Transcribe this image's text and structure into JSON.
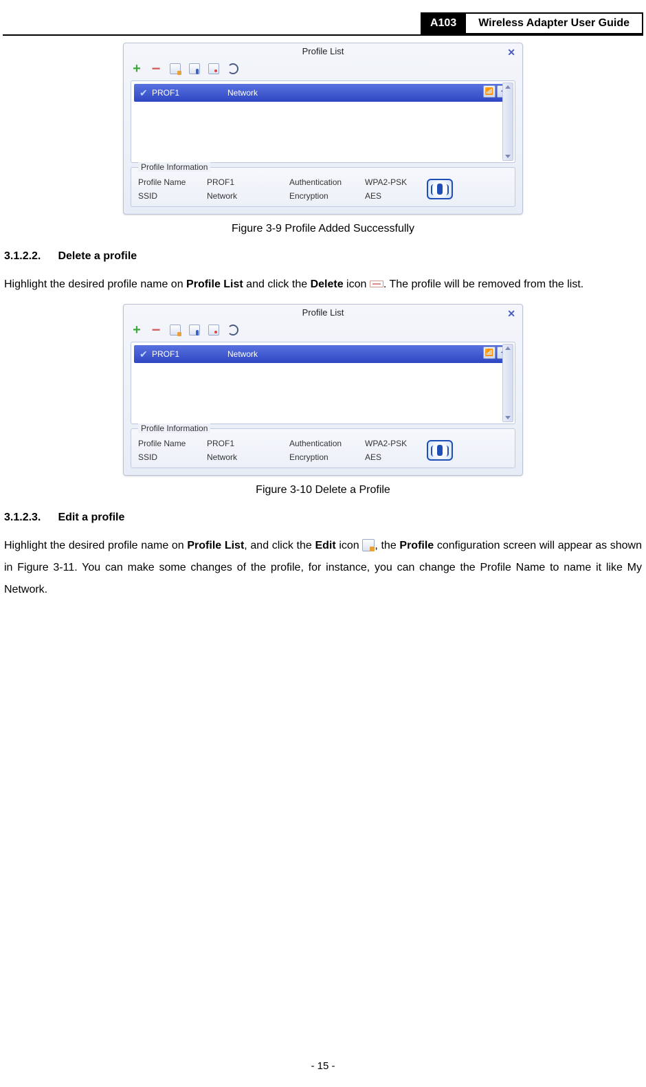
{
  "header": {
    "code": "A103",
    "title": "Wireless Adapter User Guide"
  },
  "figures": {
    "fig1": {
      "window_title": "Profile List",
      "row": {
        "name": "PROF1",
        "ssid": "Network"
      },
      "info": {
        "legend": "Profile Information",
        "profile_name_label": "Profile Name",
        "profile_name_value": "PROF1",
        "ssid_label": "SSID",
        "ssid_value": "Network",
        "auth_label": "Authentication",
        "auth_value": "WPA2-PSK",
        "enc_label": "Encryption",
        "enc_value": "AES"
      },
      "caption": "Figure 3-9 Profile Added Successfully"
    },
    "fig2": {
      "window_title": "Profile List",
      "row": {
        "name": "PROF1",
        "ssid": "Network"
      },
      "info": {
        "legend": "Profile Information",
        "profile_name_label": "Profile Name",
        "profile_name_value": "PROF1",
        "ssid_label": "SSID",
        "ssid_value": "Network",
        "auth_label": "Authentication",
        "auth_value": "WPA2-PSK",
        "enc_label": "Encryption",
        "enc_value": "AES"
      },
      "caption": "Figure 3-10 Delete a Profile"
    }
  },
  "sections": {
    "s31212": {
      "num": "3.1.2.2.",
      "title": "Delete a profile",
      "para_before": "Highlight the desired profile name on ",
      "bold1": "Profile List",
      "mid1": " and click the ",
      "bold2": "Delete",
      "mid2": " icon ",
      "after": ". The profile will be removed from the list."
    },
    "s31213": {
      "num": "3.1.2.3.",
      "title": "Edit a profile",
      "p1a": "Highlight the desired profile name on ",
      "b1": "Profile List",
      "p1b": ", and click the ",
      "b2": "Edit",
      "p1c": " icon ",
      "p1d": ", the ",
      "b3": "Profile",
      "p2": " configuration screen will appear as shown in Figure 3-11. You can make some changes of the profile, for instance, you can change the Profile Name to name it like My Network."
    }
  },
  "footer": "- 15 -"
}
